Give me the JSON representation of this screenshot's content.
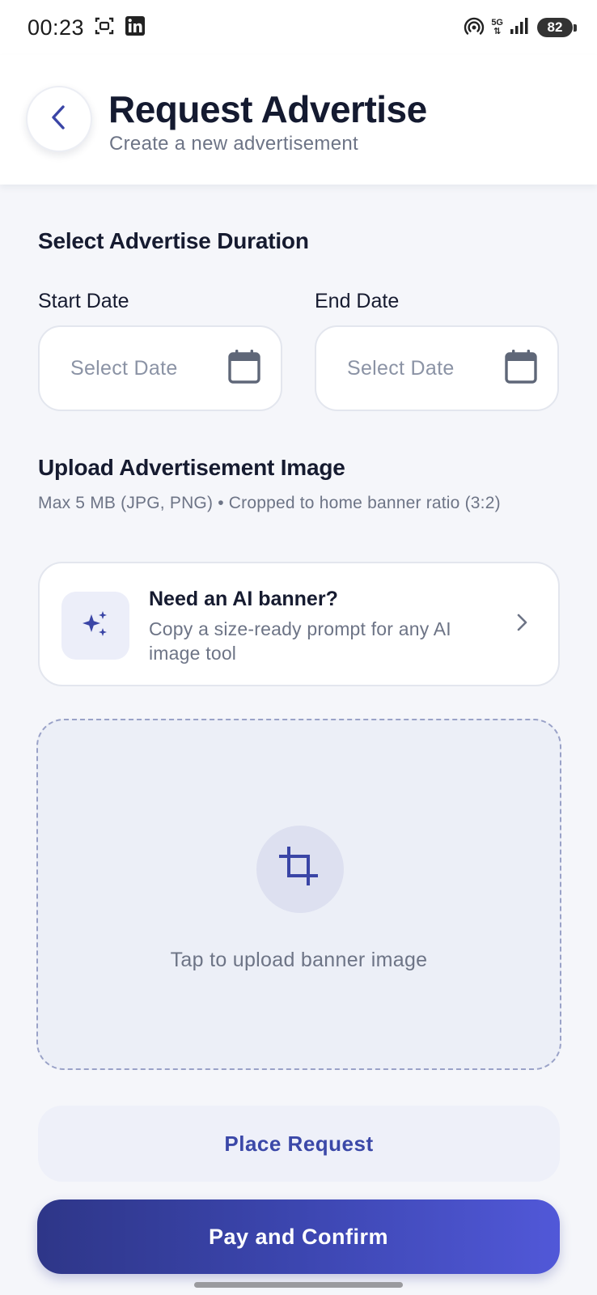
{
  "status_bar": {
    "time": "00:23",
    "network": "5G",
    "battery": "82"
  },
  "header": {
    "title": "Request Advertise",
    "subtitle": "Create a new advertisement"
  },
  "duration": {
    "section_title": "Select Advertise Duration",
    "start_label": "Start Date",
    "end_label": "End Date",
    "start_placeholder": "Select Date",
    "end_placeholder": "Select Date"
  },
  "upload": {
    "section_title": "Upload Advertisement Image",
    "hint": "Max 5 MB (JPG, PNG) • Cropped to home banner ratio (3:2)",
    "ai_card": {
      "title": "Need an AI banner?",
      "description": "Copy a size-ready prompt for any AI image tool"
    },
    "dropzone_text": "Tap to upload banner image"
  },
  "actions": {
    "place_request": "Place Request",
    "pay_confirm": "Pay and Confirm"
  },
  "icons": {
    "back": "chevron-left-icon",
    "calendar": "calendar-icon",
    "ai": "sparkles-icon",
    "chevron": "chevron-right-icon",
    "crop": "crop-icon"
  },
  "colors": {
    "accent": "#3b48a8",
    "gradient_start": "#2e3688",
    "gradient_end": "#5158d8",
    "background": "#f5f6fa"
  }
}
